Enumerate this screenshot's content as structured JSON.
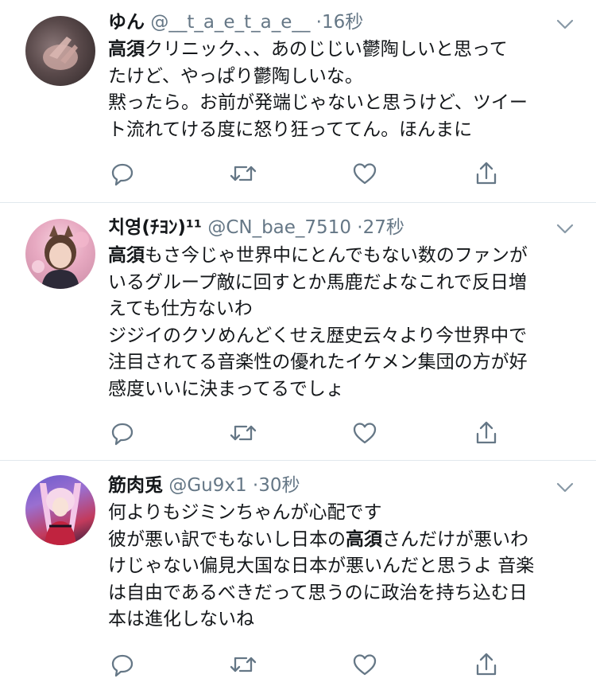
{
  "tweets": [
    {
      "name": "ゆん",
      "handle": "@__t_a_e_t_a_e__",
      "dot": "·",
      "time": "16秒",
      "lines": [
        [
          {
            "t": "高須",
            "b": true
          },
          {
            "t": "クリニック、、、あのじじい鬱陶しいと思って",
            "b": false
          }
        ],
        [
          {
            "t": "たけど、やっぱり鬱陶しいな。",
            "b": false
          }
        ],
        [
          {
            "t": "黙ったら。お前が発端じゃないと思うけど、ツイー",
            "b": false
          }
        ],
        [
          {
            "t": "ト流れてける度に怒り狂っててん。ほんまに",
            "b": false
          }
        ]
      ]
    },
    {
      "name": "치영(ﾁﾖﾝ)¹¹",
      "handle": "@CN_bae_7510",
      "dot": "·",
      "time": "27秒",
      "lines": [
        [
          {
            "t": "高須",
            "b": true
          },
          {
            "t": "もさ今じゃ世界中にとんでもない数のファンが",
            "b": false
          }
        ],
        [
          {
            "t": "いるグループ敵に回すとか馬鹿だよなこれで反日増",
            "b": false
          }
        ],
        [
          {
            "t": "えても仕方ないわ",
            "b": false
          }
        ],
        [
          {
            "t": "ジジイのクソめんどくせえ歴史云々より今世界中で",
            "b": false
          }
        ],
        [
          {
            "t": "注目されてる音楽性の優れたイケメン集団の方が好",
            "b": false
          }
        ],
        [
          {
            "t": "感度いいに決まってるでしょ",
            "b": false
          }
        ]
      ]
    },
    {
      "name": "筋肉兎",
      "handle": "@Gu9x1",
      "dot": "·",
      "time": "30秒",
      "lines": [
        [
          {
            "t": "何よりもジミンちゃんが心配です",
            "b": false
          }
        ],
        [
          {
            "t": "彼が悪い訳でもないし日本の",
            "b": false
          },
          {
            "t": "高須",
            "b": true
          },
          {
            "t": "さんだけが悪いわ",
            "b": false
          }
        ],
        [
          {
            "t": "けじゃない偏見大国な日本が悪いんだと思うよ 音楽",
            "b": false
          }
        ],
        [
          {
            "t": "は自由であるべきだって思うのに政治を持ち込む日",
            "b": false
          }
        ],
        [
          {
            "t": "本は進化しないね",
            "b": false
          }
        ]
      ]
    }
  ],
  "icons": {
    "reply": "reply-icon",
    "retweet": "retweet-icon",
    "like": "like-icon",
    "share": "share-icon",
    "menu": "chevron-down-icon"
  },
  "colors": {
    "text": "#14171a",
    "secondary": "#657786",
    "icon": "#657786",
    "divider": "#e1e8ed"
  }
}
